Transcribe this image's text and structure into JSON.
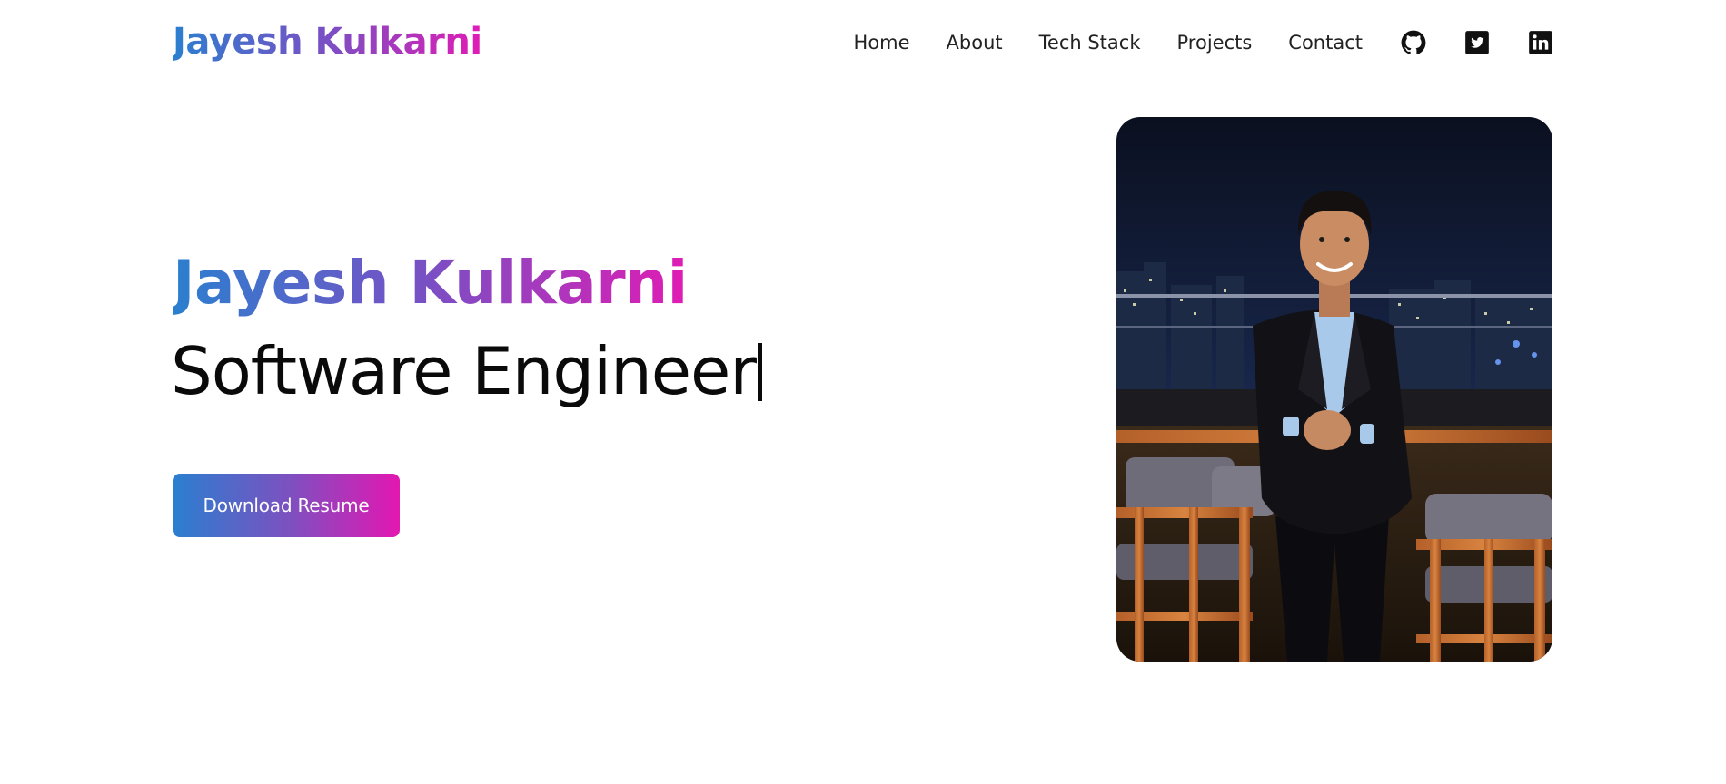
{
  "header": {
    "logo": "Jayesh Kulkarni",
    "nav": [
      "Home",
      "About",
      "Tech Stack",
      "Projects",
      "Contact"
    ],
    "social_icons": [
      "github-icon",
      "twitter-icon",
      "linkedin-icon"
    ]
  },
  "hero": {
    "name": "Jayesh Kulkarni",
    "role": "Software Engineer",
    "cta_label": "Download Resume",
    "photo_alt": "Portrait of Jayesh Kulkarni on a rooftop at night"
  },
  "colors": {
    "gradient_start": "#2b7fcf",
    "gradient_mid": "#7b4fc4",
    "gradient_end": "#e01cb4",
    "text_dark": "#0a0a0a",
    "background": "#ffffff"
  }
}
